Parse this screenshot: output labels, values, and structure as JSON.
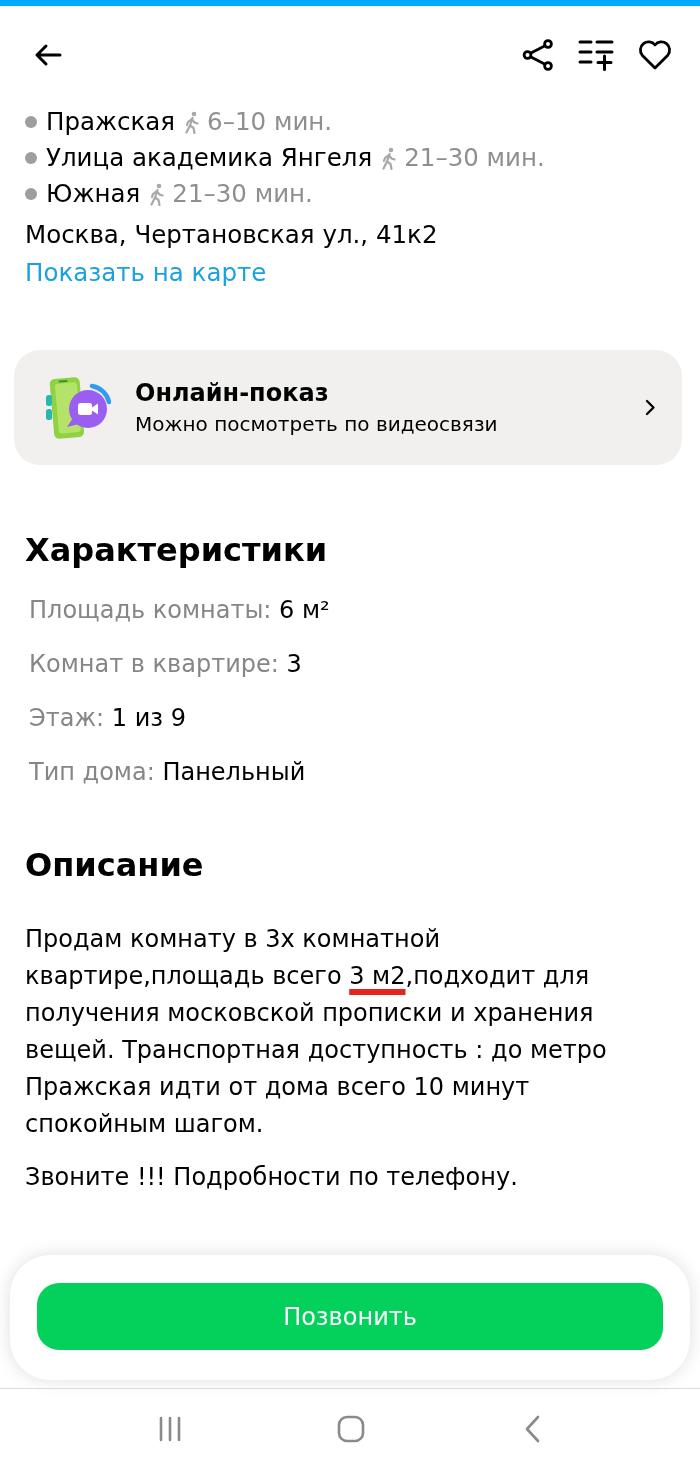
{
  "header": {
    "favorite": false
  },
  "metro": [
    {
      "station": "Пражская",
      "walk_time": "6–10 мин."
    },
    {
      "station": "Улица академика Янгеля",
      "walk_time": "21–30 мин."
    },
    {
      "station": "Южная",
      "walk_time": "21–30 мин."
    }
  ],
  "address": "Москва, Чертановская ул., 41к2",
  "map_link": "Показать на карте",
  "online_viewing": {
    "title": "Онлайн-показ",
    "subtitle": "Можно посмотреть по видеосвязи"
  },
  "characteristics": {
    "title": "Характеристики",
    "items": [
      {
        "label": "Площадь комнаты:",
        "value": "6 м²"
      },
      {
        "label": "Комнат в квартире:",
        "value": "3"
      },
      {
        "label": "Этаж:",
        "value": "1 из 9"
      },
      {
        "label": "Тип дома:",
        "value": "Панельный"
      }
    ]
  },
  "description": {
    "title": "Описание",
    "paragraphs": [
      {
        "runs": [
          {
            "text": "Продам комнату в 3х комнатной квартире,площадь всего ",
            "underlined": false
          },
          {
            "text": "3 м2",
            "underlined": true
          },
          {
            "text": ",подходит для получения московской прописки и хранения вещей. Транспортная доступность : до метро Пражская идти от дома всего 10 минут спокойным шагом.",
            "underlined": false
          }
        ]
      },
      {
        "runs": [
          {
            "text": "Звоните !!! Подробности по телефону.",
            "underlined": false
          }
        ]
      }
    ]
  },
  "call_button": "Позвонить"
}
